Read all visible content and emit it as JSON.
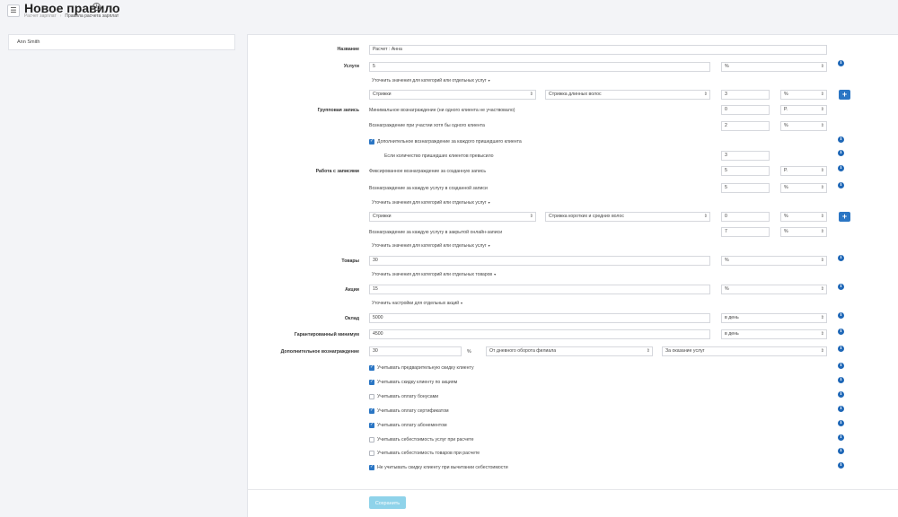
{
  "header": {
    "title": "Новое правило",
    "menu_icon": "☰",
    "info_icon": "i",
    "breadcrumb": [
      "Расчет зарплат",
      "Правила расчета зарплат"
    ]
  },
  "left_panel": {
    "employee": "Ann Smith"
  },
  "form": {
    "name_label": "Название",
    "name_value": "Расчет : Анна",
    "services_label": "Услуги",
    "services_value": "5",
    "services_unit": "%",
    "refine_categories_services": "Уточнить значения для категорий или отдельных услуг",
    "row1": {
      "category": "Стрижки",
      "service": "Стрижка длинных волос",
      "value": "3",
      "unit": "%"
    },
    "group_label": "Групповая запись",
    "min_reward_text": "Минимальное вознаграждение (ни одного клиента не участвовало)",
    "min_reward_value": "0",
    "min_reward_unit": "Р.",
    "reward_one_text": "Вознаграждение при участии хотя бы одного клиента",
    "reward_one_value": "2",
    "reward_one_unit": "%",
    "extra_each_text": "Дополнительное вознаграждение за каждого пришедшего клиента",
    "if_clients_text": "Если количество пришедших клиентов превысило",
    "if_clients_value": "3",
    "records_label": "Работа с записями",
    "fixed_reward_text": "Фиксированное вознаграждение за созданную запись",
    "fixed_reward_value": "5",
    "fixed_reward_unit": "Р.",
    "each_service_created_text": "Вознаграждение за каждую услугу в созданной записи",
    "each_service_created_value": "5",
    "each_service_created_unit": "%",
    "refine_categories_2": "Уточнить значения для категорий или отдельных услуг",
    "row2": {
      "category": "Стрижки",
      "service": "Стрижка коротких и средних волос",
      "value": "0",
      "unit": "%"
    },
    "each_service_online_text": "Вознаграждение за каждую услугу в закрытой онлайн-записи",
    "each_service_online_value": "7",
    "each_service_online_unit": "%",
    "refine_categories_3": "Уточнить значения для категорий или отдельных услуг",
    "goods_label": "Товары",
    "goods_value": "30",
    "goods_unit": "%",
    "refine_goods": "Уточнить значения для категорий или отдельных товаров",
    "promo_label": "Акции",
    "promo_value": "15",
    "promo_unit": "%",
    "refine_promo": "Уточнить настройки для отдельных акций",
    "salary_label": "Оклад",
    "salary_value": "5000",
    "salary_unit": "в день",
    "guaranteed_label": "Гарантированный минимум",
    "guaranteed_value": "4500",
    "guaranteed_unit": "в день",
    "additional_label": "Дополнительное вознаграждение",
    "additional_value": "30",
    "additional_unit": "%",
    "additional_basis": "От дневного оборота филиала",
    "additional_for": "За оказание услуг",
    "checkboxes": [
      {
        "label": "Учитывать предварительную скидку клиенту",
        "checked": true
      },
      {
        "label": "Учитывать скидку клиенту по акциям",
        "checked": true
      },
      {
        "label": "Учитывать оплату бонусами",
        "checked": false
      },
      {
        "label": "Учитывать оплату сертификатом",
        "checked": true
      },
      {
        "label": "Учитывать оплату абонементом",
        "checked": true
      },
      {
        "label": "Учитывать себестоимость услуг при расчете",
        "checked": false
      },
      {
        "label": "Учитывать себестоимость товаров при расчете",
        "checked": false
      },
      {
        "label": "Не учитывать скидку клиенту при вычитании себестоимости",
        "checked": true
      }
    ],
    "save_label": "Сохранить",
    "plus_icon": "+",
    "caret": "▾"
  },
  "colors": {
    "accent": "#1e67b7",
    "button": "#2b76c4",
    "save": "#8fd3ea"
  }
}
